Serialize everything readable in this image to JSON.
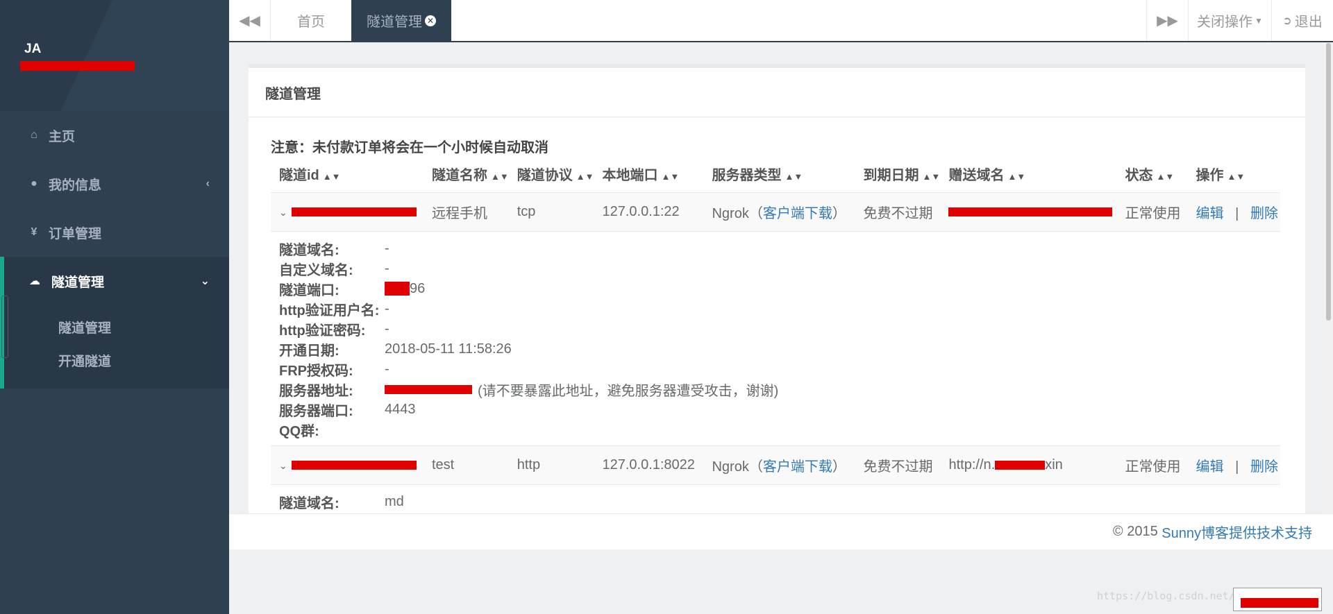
{
  "sidebar": {
    "username": "JA",
    "items": [
      {
        "label": "主页",
        "icon": "home-icon"
      },
      {
        "label": "我的信息",
        "icon": "user-icon"
      },
      {
        "label": "订单管理",
        "icon": "yen-icon"
      }
    ],
    "active": {
      "label": "隧道管理",
      "icon": "cloud-icon",
      "subitems": [
        "隧道管理",
        "开通隧道"
      ]
    }
  },
  "topbar": {
    "tabs": [
      "首页",
      "隧道管理"
    ],
    "close_ops": "关闭操作",
    "logout": "退出"
  },
  "panel": {
    "title": "隧道管理",
    "note": "注意：未付款订单将会在一个小时候自动取消"
  },
  "table": {
    "headers": [
      "隧道id",
      "隧道名称",
      "隧道协议",
      "本地端口",
      "服务器类型",
      "到期日期",
      "赠送域名",
      "状态",
      "操作"
    ],
    "rows": [
      {
        "name": "远程手机",
        "protocol": "tcp",
        "local_port": "127.0.0.1:22",
        "server_type": "Ngrok",
        "client_link": "客户端下载",
        "expiry": "免费不过期",
        "domain": "",
        "status": "正常使用",
        "edit": "编辑",
        "sep": "|",
        "delete": "删除"
      },
      {
        "name": "test",
        "protocol": "http",
        "local_port": "127.0.0.1:8022",
        "server_type": "Ngrok",
        "client_link": "客户端下载",
        "expiry": "免费不过期",
        "domain": "http://n.",
        "domain_tail": "xin",
        "status": "正常使用",
        "edit": "编辑",
        "sep": "|",
        "delete": "删除"
      }
    ],
    "detail": [
      {
        "label": "隧道域名:",
        "value": "-"
      },
      {
        "label": "自定义域名:",
        "value": "-"
      },
      {
        "label": "隧道端口:",
        "value": "96"
      },
      {
        "label": "http验证用户名:",
        "value": "-"
      },
      {
        "label": "http验证密码:",
        "value": "-"
      },
      {
        "label": "开通日期:",
        "value": "2018-05-11 11:58:26"
      },
      {
        "label": "FRP授权码:",
        "value": "-"
      },
      {
        "label": "服务器地址:",
        "value": "(请不要暴露此地址，避免服务器遭受攻击，谢谢)"
      },
      {
        "label": "服务器端口:",
        "value": "4443"
      },
      {
        "label": "QQ群:",
        "value": ""
      }
    ],
    "detail2": [
      {
        "label": "隧道域名:",
        "value": "md"
      }
    ]
  },
  "footer": {
    "copyright": "© 2015",
    "brand": "Sunny博客提供技术支持"
  },
  "watermark": "https://blog.csdn.net/jacka65432"
}
